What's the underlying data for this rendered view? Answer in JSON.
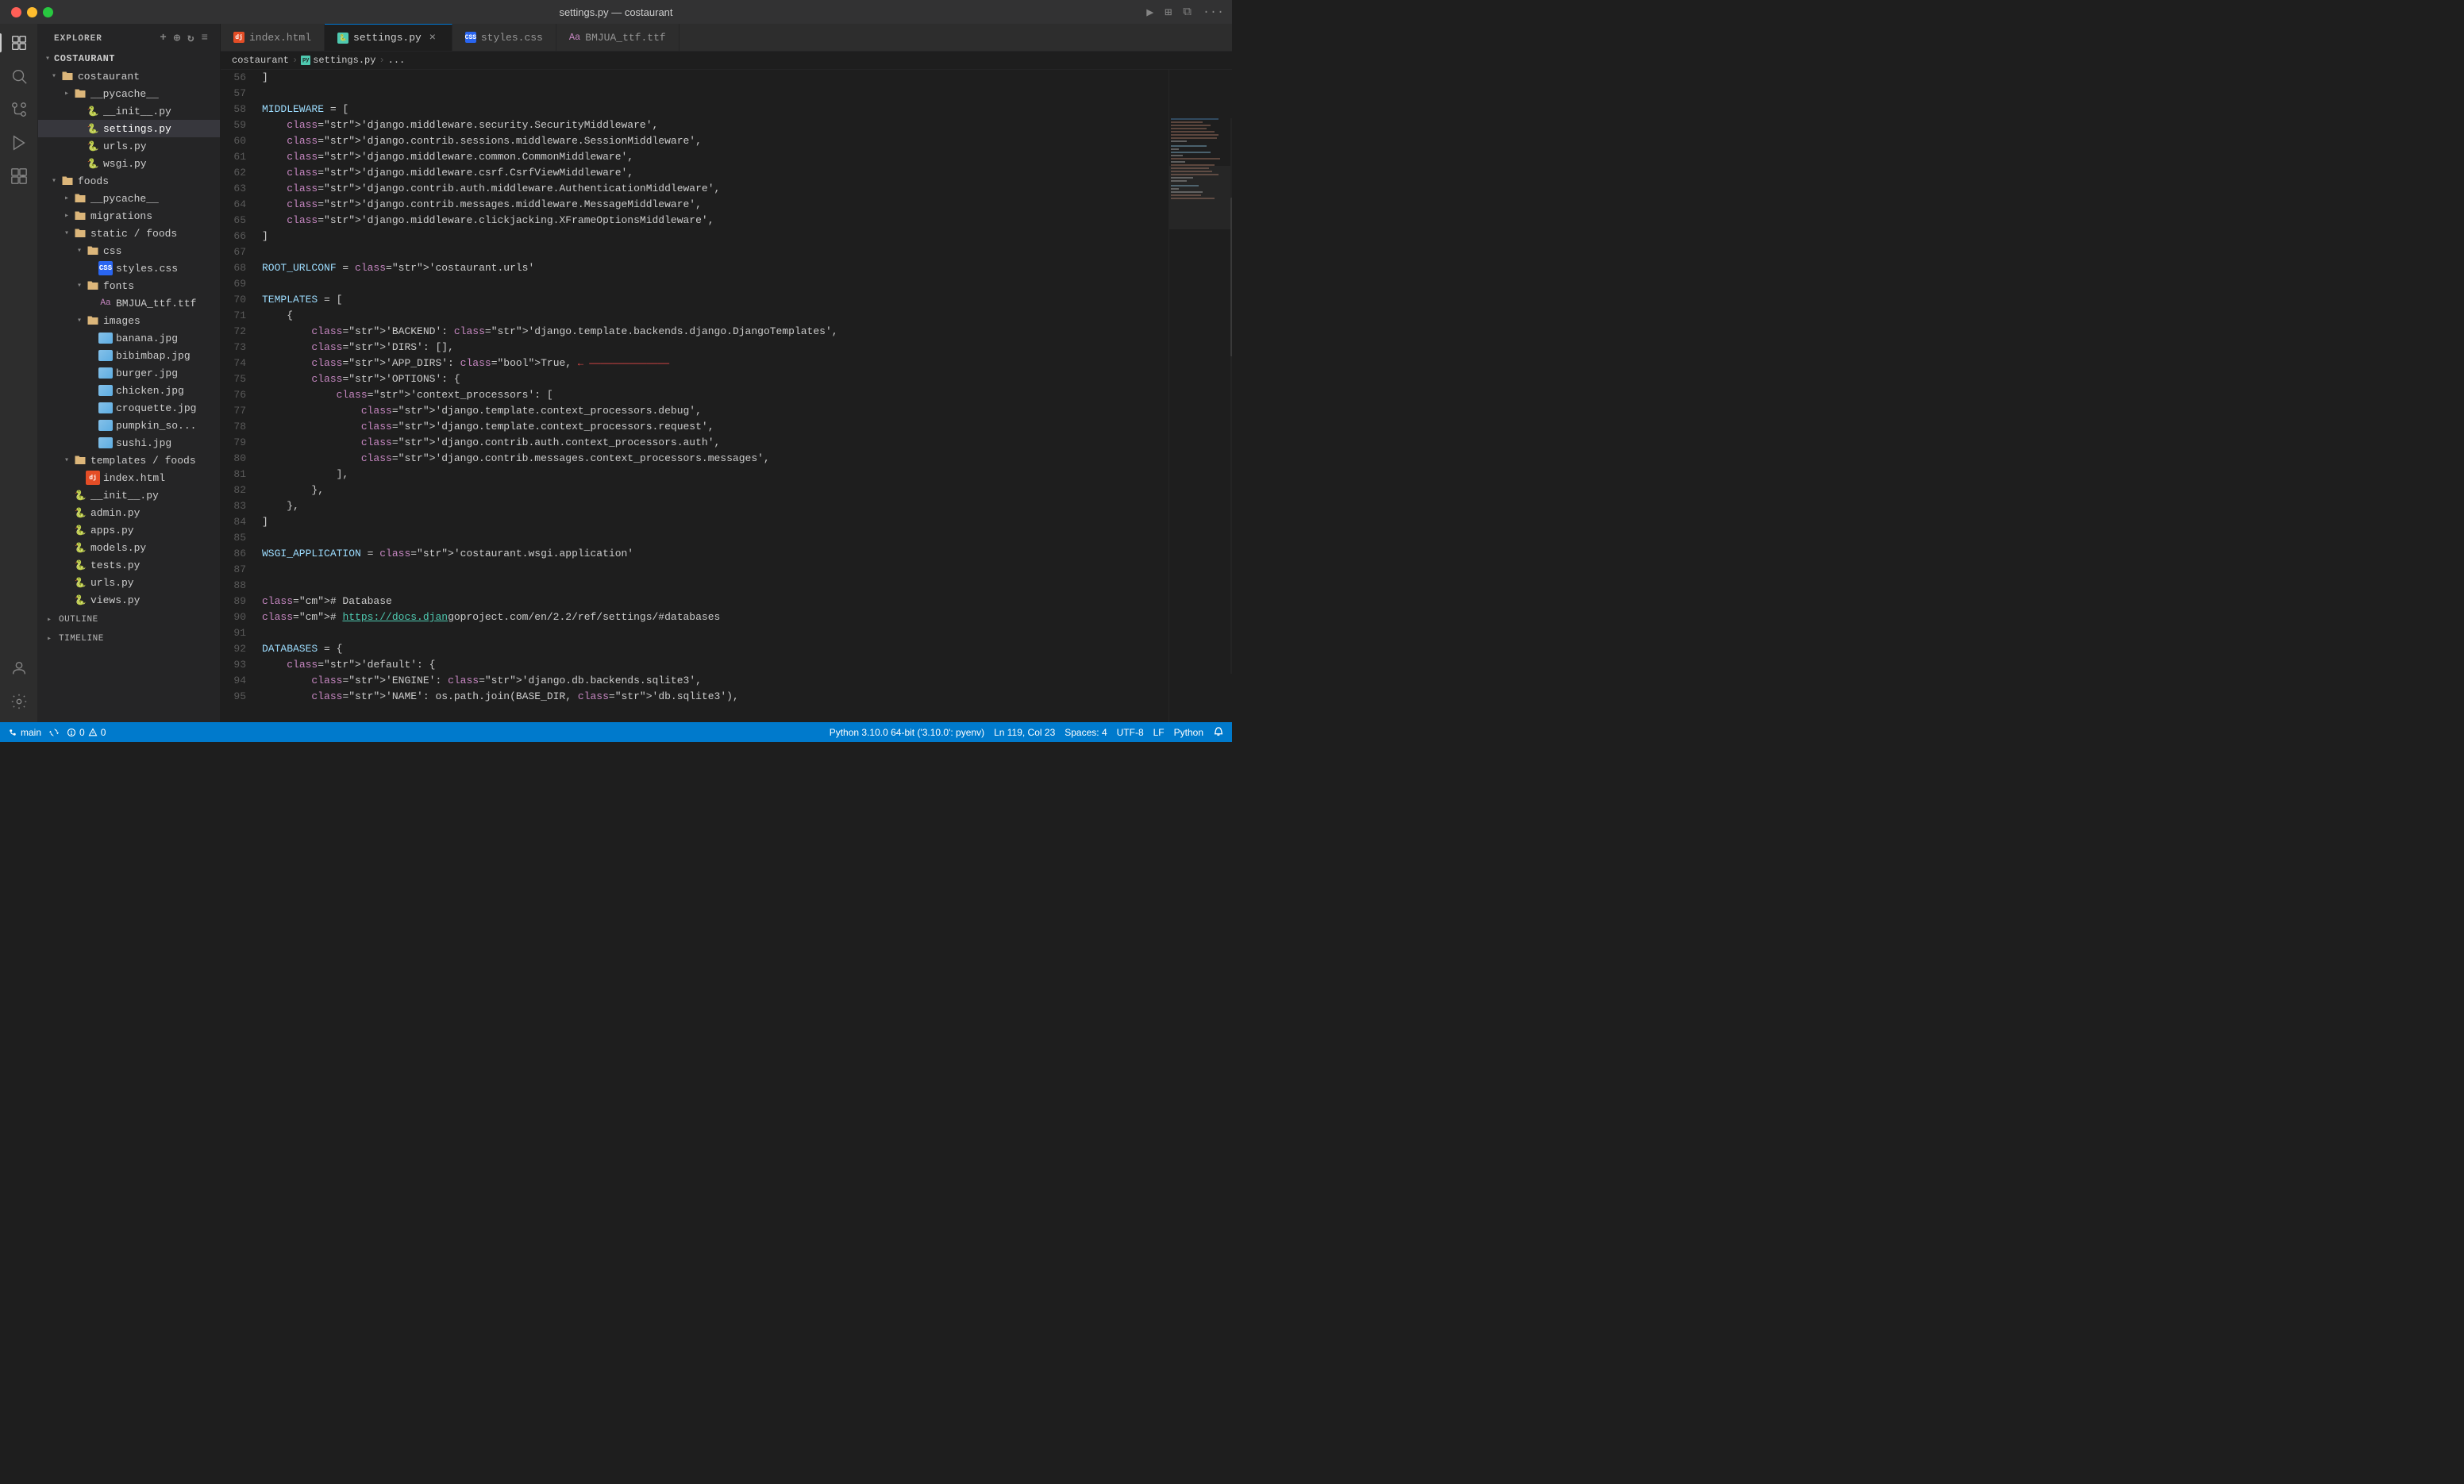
{
  "titlebar": {
    "title": "settings.py — costaurant",
    "buttons": [
      "close",
      "minimize",
      "maximize"
    ]
  },
  "tabs": [
    {
      "id": "index-html",
      "label": "index.html",
      "icon": "html",
      "active": false,
      "modified": false
    },
    {
      "id": "settings-py",
      "label": "settings.py",
      "icon": "py",
      "active": true,
      "modified": false
    },
    {
      "id": "styles-css",
      "label": "styles.css",
      "icon": "css",
      "active": false,
      "modified": false
    },
    {
      "id": "bmjua-ttf",
      "label": "BMJUA_ttf.ttf",
      "icon": "font",
      "active": false,
      "modified": false
    }
  ],
  "breadcrumb": {
    "items": [
      "costaurant",
      "settings.py",
      "..."
    ]
  },
  "sidebar": {
    "title": "EXPLORER",
    "tree": [
      {
        "id": "costaurant-root",
        "label": "COSTAURANT",
        "type": "root",
        "indent": 0,
        "expanded": true,
        "active": false
      },
      {
        "id": "costaurant-folder",
        "label": "costaurant",
        "type": "folder",
        "indent": 1,
        "expanded": true,
        "active": false
      },
      {
        "id": "pycache-folder",
        "label": "__pycache__",
        "type": "folder",
        "indent": 2,
        "expanded": false,
        "active": false
      },
      {
        "id": "init-py",
        "label": "__init__.py",
        "type": "py",
        "indent": 3,
        "active": false
      },
      {
        "id": "settings-py",
        "label": "settings.py",
        "type": "py",
        "indent": 3,
        "active": true
      },
      {
        "id": "urls-py",
        "label": "urls.py",
        "type": "py",
        "indent": 3,
        "active": false
      },
      {
        "id": "wsgi-py",
        "label": "wsgi.py",
        "type": "py",
        "indent": 3,
        "active": false
      },
      {
        "id": "foods-folder",
        "label": "foods",
        "type": "folder",
        "indent": 1,
        "expanded": true,
        "active": false
      },
      {
        "id": "foods-pycache",
        "label": "__pycache__",
        "type": "folder",
        "indent": 2,
        "expanded": false,
        "active": false
      },
      {
        "id": "foods-migrations",
        "label": "migrations",
        "type": "folder",
        "indent": 2,
        "expanded": false,
        "active": false
      },
      {
        "id": "static-foods",
        "label": "static / foods",
        "type": "folder",
        "indent": 2,
        "expanded": true,
        "active": false
      },
      {
        "id": "css-folder",
        "label": "css",
        "type": "folder",
        "indent": 3,
        "expanded": true,
        "active": false
      },
      {
        "id": "styles-css",
        "label": "styles.css",
        "type": "css",
        "indent": 4,
        "active": false
      },
      {
        "id": "fonts-folder",
        "label": "fonts",
        "type": "folder",
        "indent": 3,
        "expanded": true,
        "active": false
      },
      {
        "id": "bmjua-font",
        "label": "BMJUA_ttf.ttf",
        "type": "font",
        "indent": 4,
        "active": false
      },
      {
        "id": "images-folder",
        "label": "images",
        "type": "folder",
        "indent": 3,
        "expanded": true,
        "active": false
      },
      {
        "id": "banana-jpg",
        "label": "banana.jpg",
        "type": "img",
        "indent": 4,
        "active": false
      },
      {
        "id": "bibimbap-jpg",
        "label": "bibimbap.jpg",
        "type": "img",
        "indent": 4,
        "active": false
      },
      {
        "id": "burger-jpg",
        "label": "burger.jpg",
        "type": "img",
        "indent": 4,
        "active": false
      },
      {
        "id": "chicken-jpg",
        "label": "chicken.jpg",
        "type": "img",
        "indent": 4,
        "active": false
      },
      {
        "id": "croquette-jpg",
        "label": "croquette.jpg",
        "type": "img",
        "indent": 4,
        "active": false
      },
      {
        "id": "pumpkin-jpg",
        "label": "pumpkin_so...",
        "type": "img",
        "indent": 4,
        "active": false
      },
      {
        "id": "sushi-jpg",
        "label": "sushi.jpg",
        "type": "img",
        "indent": 4,
        "active": false
      },
      {
        "id": "templates-foods",
        "label": "templates / foods",
        "type": "folder",
        "indent": 2,
        "expanded": true,
        "active": false
      },
      {
        "id": "index-html",
        "label": "index.html",
        "type": "html",
        "indent": 3,
        "active": false
      },
      {
        "id": "foods-init",
        "label": "__init__.py",
        "type": "py",
        "indent": 2,
        "active": false
      },
      {
        "id": "foods-admin",
        "label": "admin.py",
        "type": "py",
        "indent": 2,
        "active": false
      },
      {
        "id": "foods-apps",
        "label": "apps.py",
        "type": "py",
        "indent": 2,
        "active": false
      },
      {
        "id": "foods-models",
        "label": "models.py",
        "type": "py",
        "indent": 2,
        "active": false
      },
      {
        "id": "foods-tests",
        "label": "tests.py",
        "type": "py",
        "indent": 2,
        "active": false
      },
      {
        "id": "foods-urls",
        "label": "urls.py",
        "type": "py",
        "indent": 2,
        "active": false
      },
      {
        "id": "foods-views",
        "label": "views.py",
        "type": "py",
        "indent": 2,
        "active": false
      }
    ],
    "outline_label": "OUTLINE",
    "timeline_label": "TIMELINE"
  },
  "code": {
    "lines": [
      {
        "n": 56,
        "text": "]"
      },
      {
        "n": 57,
        "text": ""
      },
      {
        "n": 58,
        "text": "MIDDLEWARE = ["
      },
      {
        "n": 59,
        "text": "    'django.middleware.security.SecurityMiddleware',"
      },
      {
        "n": 60,
        "text": "    'django.contrib.sessions.middleware.SessionMiddleware',"
      },
      {
        "n": 61,
        "text": "    'django.middleware.common.CommonMiddleware',"
      },
      {
        "n": 62,
        "text": "    'django.middleware.csrf.CsrfViewMiddleware',"
      },
      {
        "n": 63,
        "text": "    'django.contrib.auth.middleware.AuthenticationMiddleware',"
      },
      {
        "n": 64,
        "text": "    'django.contrib.messages.middleware.MessageMiddleware',"
      },
      {
        "n": 65,
        "text": "    'django.middleware.clickjacking.XFrameOptionsMiddleware',"
      },
      {
        "n": 66,
        "text": "]"
      },
      {
        "n": 67,
        "text": ""
      },
      {
        "n": 68,
        "text": "ROOT_URLCONF = 'costaurant.urls'"
      },
      {
        "n": 69,
        "text": ""
      },
      {
        "n": 70,
        "text": "TEMPLATES = ["
      },
      {
        "n": 71,
        "text": "    {"
      },
      {
        "n": 72,
        "text": "        'BACKEND': 'django.template.backends.django.DjangoTemplates',"
      },
      {
        "n": 73,
        "text": "        'DIRS': [],"
      },
      {
        "n": 74,
        "text": "        'APP_DIRS': True,",
        "annotation": true
      },
      {
        "n": 75,
        "text": "        'OPTIONS': {"
      },
      {
        "n": 76,
        "text": "            'context_processors': ["
      },
      {
        "n": 77,
        "text": "                'django.template.context_processors.debug',"
      },
      {
        "n": 78,
        "text": "                'django.template.context_processors.request',"
      },
      {
        "n": 79,
        "text": "                'django.contrib.auth.context_processors.auth',"
      },
      {
        "n": 80,
        "text": "                'django.contrib.messages.context_processors.messages',"
      },
      {
        "n": 81,
        "text": "            ],"
      },
      {
        "n": 82,
        "text": "        },"
      },
      {
        "n": 83,
        "text": "    },"
      },
      {
        "n": 84,
        "text": "]"
      },
      {
        "n": 85,
        "text": ""
      },
      {
        "n": 86,
        "text": "WSGI_APPLICATION = 'costaurant.wsgi.application'"
      },
      {
        "n": 87,
        "text": ""
      },
      {
        "n": 88,
        "text": ""
      },
      {
        "n": 89,
        "text": "# Database"
      },
      {
        "n": 90,
        "text": "# https://docs.djangoproject.com/en/2.2/ref/settings/#databases"
      },
      {
        "n": 91,
        "text": ""
      },
      {
        "n": 92,
        "text": "DATABASES = {"
      },
      {
        "n": 93,
        "text": "    'default': {"
      },
      {
        "n": 94,
        "text": "        'ENGINE': 'django.db.backends.sqlite3',"
      },
      {
        "n": 95,
        "text": "        'NAME': os.path.join(BASE_DIR, 'db.sqlite3'),"
      }
    ]
  },
  "status_bar": {
    "branch": "main",
    "sync": "sync",
    "errors": "0",
    "warnings": "0",
    "python_version": "Python 3.10.0 64-bit ('3.10.0': pyenv)",
    "ln_col": "Ln 119, Col 23",
    "spaces": "Spaces: 4",
    "encoding": "UTF-8",
    "line_ending": "LF",
    "language": "Python",
    "notifications": ""
  }
}
